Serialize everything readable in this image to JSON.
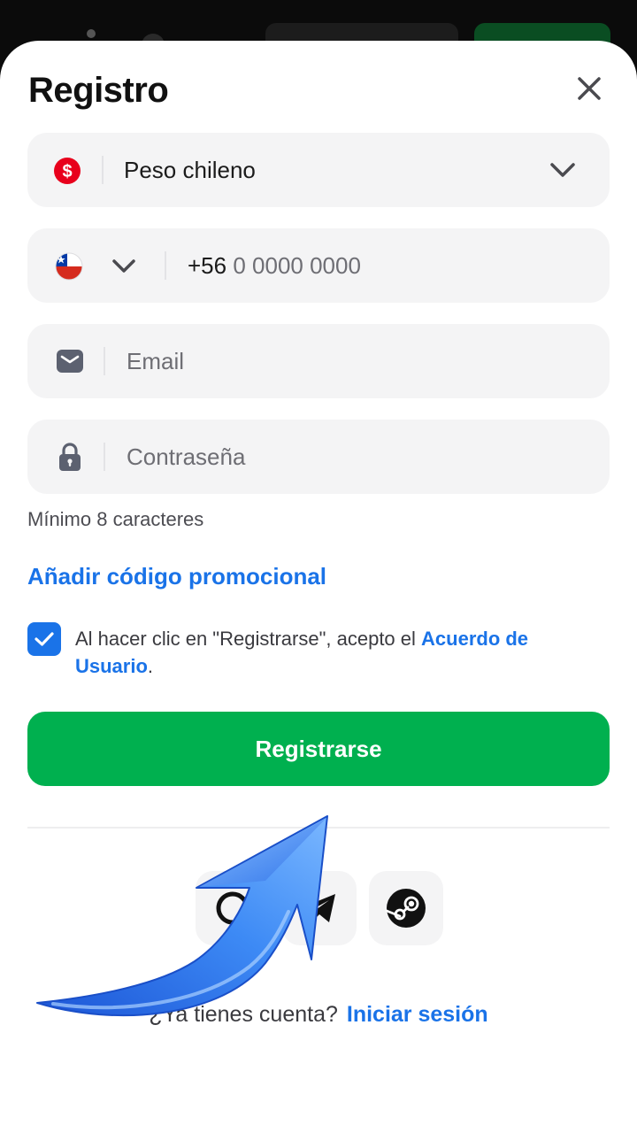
{
  "header": {
    "title": "Registro"
  },
  "currency": {
    "value": "Peso chileno"
  },
  "phone": {
    "prefix": "+56",
    "placeholder": "0 0000 0000"
  },
  "email": {
    "placeholder": "Email"
  },
  "password": {
    "placeholder": "Contraseña",
    "hint": "Mínimo 8 caracteres"
  },
  "promo": {
    "label": "Añadir código promocional"
  },
  "terms": {
    "checked": true,
    "text": "Al hacer clic en \"Registrarse\", acepto el ",
    "link": "Acuerdo de Usuario",
    "end": "."
  },
  "submit": {
    "label": "Registrarse"
  },
  "social": {
    "providers": [
      "google-icon",
      "telegram-icon",
      "steam-icon"
    ]
  },
  "login": {
    "question_partial": "¿Ya tienes cuenta?",
    "link": "Iniciar sesión"
  },
  "colors": {
    "accent": "#1a73e8",
    "primary_button": "#00b04f",
    "field_bg": "#f4f4f5",
    "currency_badge": "#e8001c",
    "overlay_arrow": "#2f7cf0"
  }
}
